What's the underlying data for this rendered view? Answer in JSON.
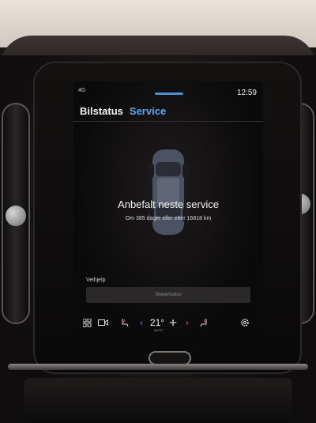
{
  "status_bar": {
    "signal": "4G",
    "time": "12:59"
  },
  "tabs": [
    {
      "label": "Bilstatus",
      "active": false
    },
    {
      "label": "Service",
      "active": true
    }
  ],
  "service": {
    "headline": "Anbefalt neste service",
    "detail": "Om 385 dager eller etter 16818 km"
  },
  "assist": {
    "label": "Veihjelp",
    "mode_button": "Slepemodus"
  },
  "climate_bar": {
    "left_icon": "grid-icon",
    "camera_icon": "camera-icon",
    "seat_heat_icon": "seat-heat-icon",
    "temperature": "21°",
    "auto_label": "AUTO",
    "fan_icon": "fan-icon",
    "right_seat_icon": "seat-heat-right-icon",
    "settings_icon": "settings-icon"
  },
  "colors": {
    "accent": "#5aa7ef",
    "temp_down": "#4a8fd8",
    "temp_up": "#e05555"
  }
}
